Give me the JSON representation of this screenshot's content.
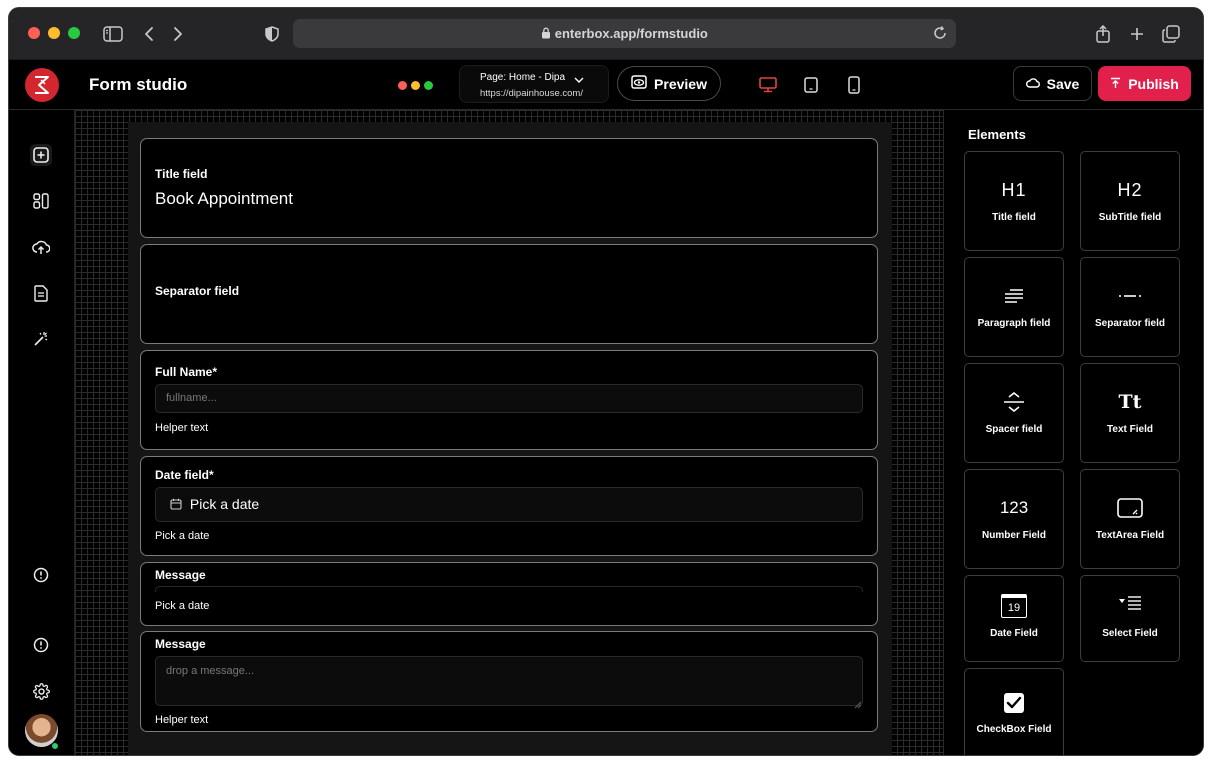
{
  "browser": {
    "url": "enterbox.app/formstudio"
  },
  "header": {
    "title": "Form studio",
    "page_label": "Page: Home - Dipa",
    "page_url": "https://dipainhouse.com/",
    "preview_label": "Preview",
    "save_label": "Save",
    "publish_label": "Publish"
  },
  "canvas": {
    "title_field": {
      "label": "Title field",
      "value": "Book Appointment"
    },
    "separator_field": {
      "label": "Separator field"
    },
    "fullname_field": {
      "label": "Full Name*",
      "placeholder": "fullname...",
      "helper": "Helper text"
    },
    "date_field": {
      "label": "Date field*",
      "value": "Pick a date",
      "helper": "Pick a date"
    },
    "message_field_collapsed": {
      "label": "Message",
      "helper": "Pick a date"
    },
    "message_field": {
      "label": "Message",
      "placeholder": "drop a message...",
      "helper": "Helper text"
    }
  },
  "elements": {
    "title": "Elements",
    "items": [
      {
        "icon": "H1",
        "label": "Title field"
      },
      {
        "icon": "H2",
        "label": "SubTitle field"
      },
      {
        "icon": "paragraph-icon",
        "label": "Paragraph field"
      },
      {
        "icon": "separator-icon",
        "label": "Separator field"
      },
      {
        "icon": "spacer-icon",
        "label": "Spacer field"
      },
      {
        "icon": "Tt",
        "label": "Text Field"
      },
      {
        "icon": "123",
        "label": "Number Field"
      },
      {
        "icon": "textarea-icon",
        "label": "TextArea Field"
      },
      {
        "icon": "19",
        "label": "Date Field"
      },
      {
        "icon": "select-icon",
        "label": "Select Field"
      },
      {
        "icon": "checkbox-icon",
        "label": "CheckBox Field"
      }
    ]
  },
  "colors": {
    "accent": "#e2204c",
    "logo": "#d3262e",
    "device_active": "#e2453c"
  }
}
